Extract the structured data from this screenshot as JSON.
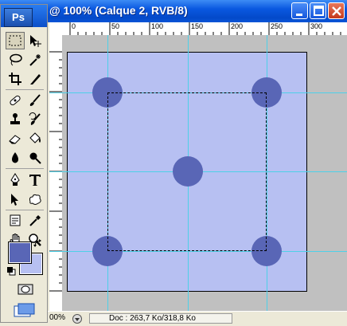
{
  "window": {
    "title": "@ 100% (Calque 2, RVB/8)",
    "buttons": [
      "minimize",
      "maximize",
      "close"
    ]
  },
  "toolbox": {
    "logo": "Ps",
    "tools": [
      "rectangular-marquee-icon",
      "move-icon",
      "lasso-icon",
      "magic-wand-icon",
      "crop-icon",
      "slice-icon",
      "healing-brush-icon",
      "brush-icon",
      "clone-stamp-icon",
      "history-brush-icon",
      "eraser-icon",
      "paint-bucket-icon",
      "blur-icon",
      "dodge-icon",
      "pen-icon",
      "type-icon",
      "path-selection-icon",
      "custom-shape-icon",
      "notes-icon",
      "eyedropper-icon",
      "hand-icon",
      "zoom-icon"
    ],
    "foreground_color": "#5966b6",
    "background_color": "#b7c0f2"
  },
  "ruler": {
    "top_labels": [
      "0",
      "50",
      "100",
      "150",
      "200",
      "250",
      "300"
    ]
  },
  "document": {
    "fill_color": "#b7c0f2",
    "dot_color": "#5966b6",
    "guide_color": "#4ed0e8"
  },
  "status": {
    "zoom": "00%",
    "doc_info": "Doc : 263,7 Ko/318,8 Ko"
  }
}
